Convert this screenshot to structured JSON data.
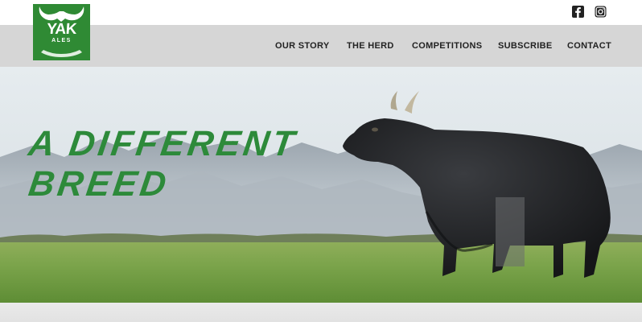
{
  "brand": {
    "logo_main": "YAK",
    "logo_sub": "ALES"
  },
  "social": {
    "facebook_icon": "facebook-icon",
    "instagram_icon": "instagram-icon"
  },
  "nav": {
    "items": [
      {
        "label": "OUR STORY"
      },
      {
        "label": "THE HERD"
      },
      {
        "label": "COMPETITIONS"
      },
      {
        "label": "SUBSCRIBE"
      },
      {
        "label": "CONTACT"
      }
    ]
  },
  "hero": {
    "line1": "A DIFFERENT",
    "line2": "BREED"
  },
  "colors": {
    "brand_green": "#2f8a34",
    "nav_bar": "#d6d6d6",
    "headline_green": "#2d8a3a"
  }
}
